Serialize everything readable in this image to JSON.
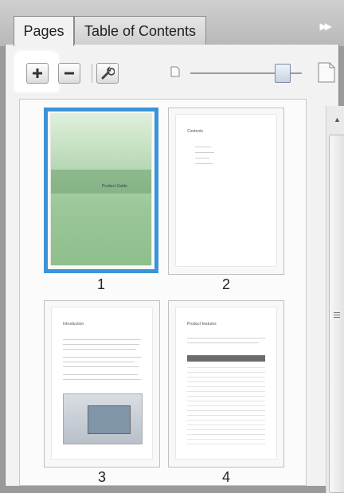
{
  "tabs": [
    {
      "label": "Pages",
      "active": true
    },
    {
      "label": "Table of Contents",
      "active": false
    }
  ],
  "panel_menu_icon": "double-chevron-right-icon",
  "toolbar": {
    "add_icon": "plus-icon",
    "remove_icon": "minus-icon",
    "tools_icon": "wrench-icon",
    "zoom_min_icon": "small-page-icon",
    "zoom_max_icon": "large-page-icon",
    "zoom_level_fraction": 0.8
  },
  "thumbnails": [
    {
      "number": "1",
      "selected": true,
      "page_texts": [
        "Product Guide"
      ]
    },
    {
      "number": "2",
      "selected": false,
      "page_texts": [
        "Contents"
      ]
    },
    {
      "number": "3",
      "selected": false,
      "page_texts": [
        "Introduction"
      ]
    },
    {
      "number": "4",
      "selected": false,
      "page_texts": [
        "Product features"
      ]
    }
  ],
  "colors": {
    "selection": "#3b94d9",
    "cover_green": "#9cc79a",
    "highlight": "#ffffff"
  }
}
